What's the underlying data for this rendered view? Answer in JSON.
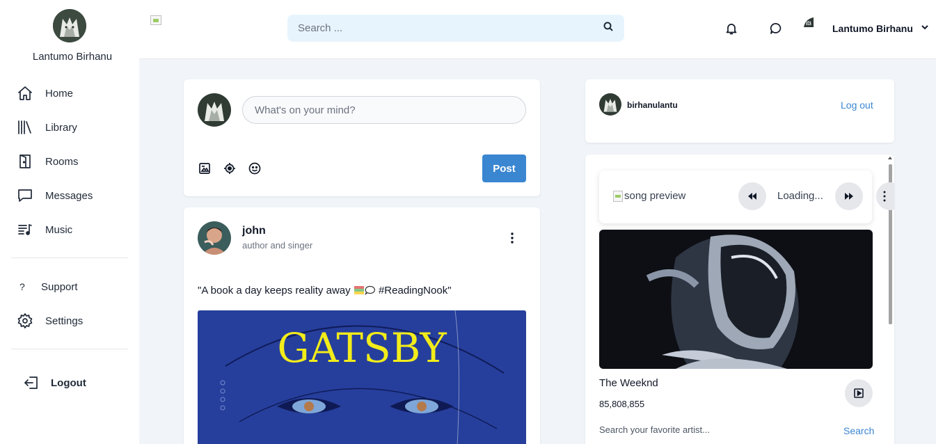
{
  "sidebar": {
    "user_name": "Lantumo Birhanu",
    "nav": [
      {
        "label": "Home",
        "icon": "home-icon"
      },
      {
        "label": "Library",
        "icon": "library-icon"
      },
      {
        "label": "Rooms",
        "icon": "door-icon"
      },
      {
        "label": "Messages",
        "icon": "message-icon"
      },
      {
        "label": "Music",
        "icon": "music-list-icon"
      }
    ],
    "support": {
      "glyph": "?",
      "label": "Support"
    },
    "settings": {
      "label": "Settings",
      "icon": "gear-icon"
    },
    "logout": {
      "label": "Logout",
      "icon": "logout-icon"
    }
  },
  "header": {
    "search_placeholder": "Search ...",
    "user_name": "Lantumo Birhanu"
  },
  "composer": {
    "placeholder": "What's on your mind?",
    "tools": [
      "image-icon",
      "location-icon",
      "emoji-icon"
    ],
    "post_label": "Post"
  },
  "post": {
    "author": "john",
    "role": "author and singer",
    "text_before": "\"A book a day keeps reality away ",
    "text_after": " #ReadingNook\"",
    "image_title": "GATSBY"
  },
  "account": {
    "handle": "birhanulantu",
    "logout_label": "Log out"
  },
  "music": {
    "preview_alt": "song preview",
    "status": "Loading...",
    "artist": "The Weeknd",
    "followers": "85,808,855",
    "search_placeholder": "Search your favorite artist...",
    "search_label": "Search"
  },
  "colors": {
    "accent": "#3a86d1",
    "background": "#f1f5f9",
    "search_bg": "#e8f4fd"
  }
}
